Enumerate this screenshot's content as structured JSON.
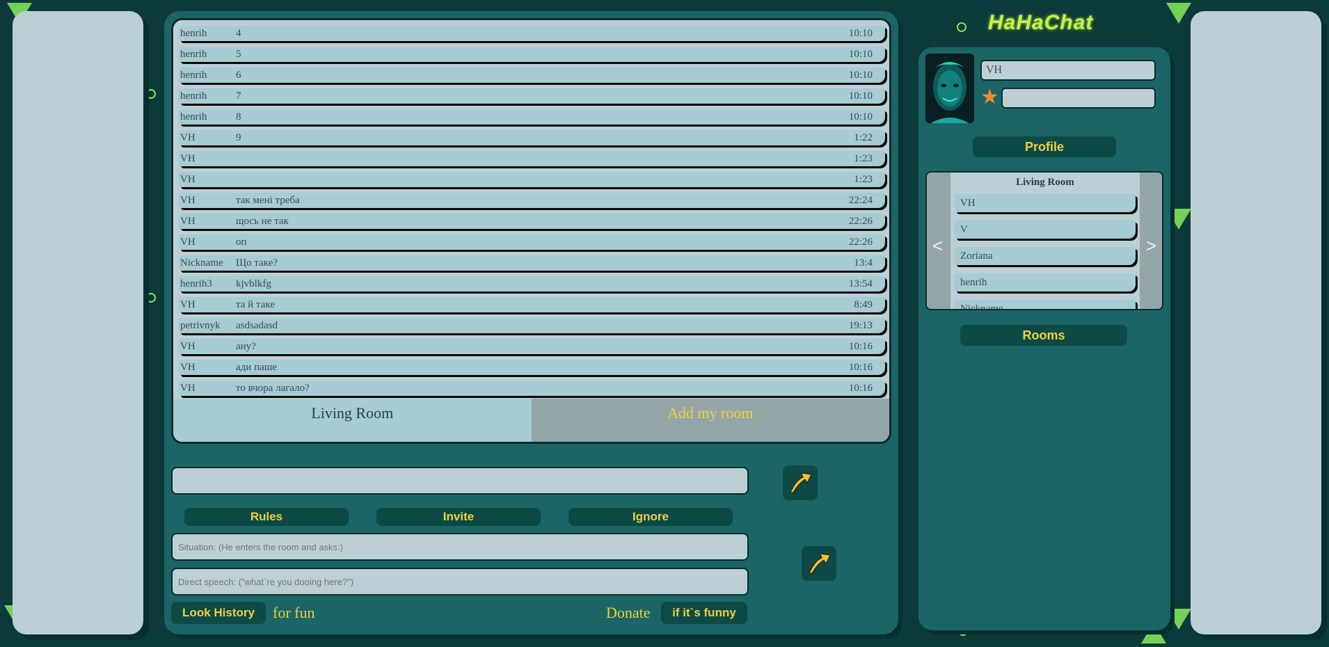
{
  "messages": [
    {
      "nick": "henrih",
      "text": "4",
      "time": "10:10"
    },
    {
      "nick": "henrih",
      "text": "5",
      "time": "10:10"
    },
    {
      "nick": "henrih",
      "text": "6",
      "time": "10:10"
    },
    {
      "nick": "henrih",
      "text": "7",
      "time": "10:10"
    },
    {
      "nick": "henrih",
      "text": "8",
      "time": "10:10"
    },
    {
      "nick": "VH",
      "text": "9",
      "time": "1:22"
    },
    {
      "nick": "VH",
      "text": "",
      "time": "1:23"
    },
    {
      "nick": "VH",
      "text": "",
      "time": "1:23"
    },
    {
      "nick": "VH",
      "text": "так мені треба",
      "time": "22:24"
    },
    {
      "nick": "VH",
      "text": "щось не так",
      "time": "22:26"
    },
    {
      "nick": "VH",
      "text": "оп",
      "time": "22:26"
    },
    {
      "nick": "Nickname",
      "text": "Що таке?",
      "time": "13:4"
    },
    {
      "nick": "henrih3",
      "text": "kjvblkfg",
      "time": "13:54"
    },
    {
      "nick": "VH",
      "text": "та й таке",
      "time": "8:49"
    },
    {
      "nick": "petrivnyk",
      "text": "asdsadasd",
      "time": "19:13"
    },
    {
      "nick": "VH",
      "text": "ану?",
      "time": "10:16"
    },
    {
      "nick": "VH",
      "text": "ади паше",
      "time": "10:16"
    },
    {
      "nick": "VH",
      "text": "то вчора лагало?",
      "time": "10:16"
    }
  ],
  "room_tabs": {
    "current": "Living Room",
    "add": "Add my room"
  },
  "buttons": {
    "rules": "Rules",
    "invite": "Invite",
    "ignore": "Ignore",
    "look_history": "Look History",
    "donate": "if it`s funny",
    "profile": "Profile",
    "rooms": "Rooms"
  },
  "fields": {
    "situation_placeholder": "Situation: (He enters the room and asks:)",
    "speech_placeholder": "Direct speech: (\"what`re you dooing here?\")"
  },
  "footer": {
    "for_fun": "for fun",
    "donate_label": "Donate"
  },
  "logo": "HaHaChat",
  "profile": {
    "name": "VH"
  },
  "room_list": {
    "title": "Living Room",
    "users": [
      "VH",
      "V",
      "Zoriana",
      "henrih",
      "Nickname"
    ],
    "prev": "<",
    "next": ">"
  },
  "colors": {
    "accent": "#f1d13c",
    "panel": "#1b6566",
    "button": "#0d4a46",
    "light": "#bccfd4"
  }
}
